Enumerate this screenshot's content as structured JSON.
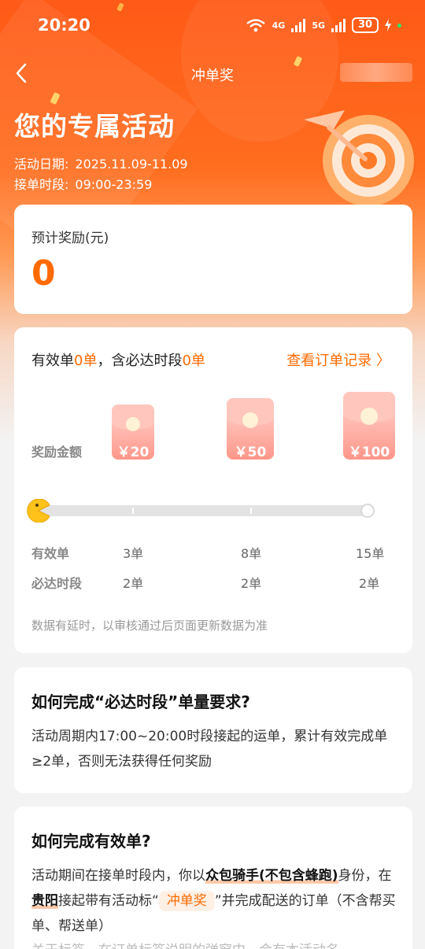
{
  "status_bar": {
    "time": "20:20",
    "net1": "4G",
    "net2": "5G",
    "battery": "30"
  },
  "nav": {
    "title": "冲单奖",
    "back_icon": "chevron-left-icon"
  },
  "hero": {
    "title": "您的专属活动",
    "date_label": "活动日期:",
    "date_value": "2025.11.09-11.09",
    "hours_label": "接单时段:",
    "hours_value": "09:00-23:59"
  },
  "reward": {
    "label": "预计奖励(元)",
    "amount": "0"
  },
  "progress": {
    "valid_prefix": "有效单",
    "valid_count": "0单",
    "mid_text": "，含必达时段",
    "must_count": "0单",
    "record_link": "查看订单记录 〉",
    "reward_label": "奖励金额",
    "tiers": [
      {
        "reward": "￥20",
        "valid": "3单",
        "must": "2单"
      },
      {
        "reward": "￥50",
        "valid": "8单",
        "must": "2单"
      },
      {
        "reward": "￥100",
        "valid": "15单",
        "must": "2单"
      }
    ],
    "current_fraction": 0,
    "row_valid_label": "有效单",
    "row_must_label": "必达时段",
    "note": "数据有延时，以审核通过后页面更新数据为准"
  },
  "faq1": {
    "title": "如何完成“必达时段”单量要求?",
    "body": "活动周期内17:00~20:00时段接起的运单，累计有效完成单 ≥2单，否则无法获得任何奖励"
  },
  "faq2": {
    "title": "如何完成有效单?",
    "p1": "活动期间在接单时段内，你以",
    "hl1": "众包骑手(不包含蜂跑)",
    "p2": "身份，在",
    "hl2": "贵阳",
    "p3": "接起带有活动标“",
    "tag": "冲单奖",
    "p4": "”并完成配送的订单（不含帮买单、帮送单）",
    "cut": "关于标签，在订单标签说明的弹窗中，会有本活动名"
  },
  "colors": {
    "accent": "#ff6a00",
    "hero": "#ff5a17",
    "envelope": "#ffb4aa"
  }
}
